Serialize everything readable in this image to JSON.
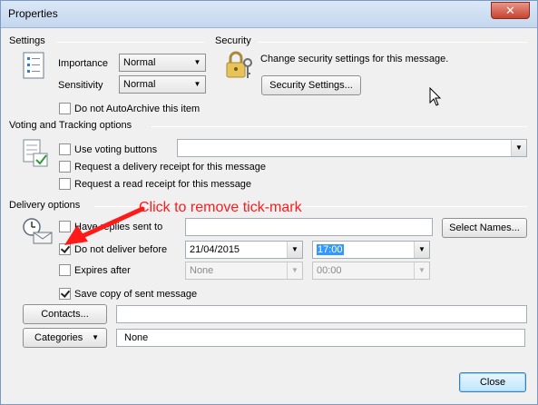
{
  "window": {
    "title": "Properties",
    "close_glyph": "✕"
  },
  "settings": {
    "heading": "Settings",
    "importance_label": "Importance",
    "importance_value": "Normal",
    "sensitivity_label": "Sensitivity",
    "sensitivity_value": "Normal",
    "autoarchive_label": "Do not AutoArchive this item",
    "autoarchive_checked": false
  },
  "security": {
    "heading": "Security",
    "description": "Change security settings for this message.",
    "button_label": "Security Settings..."
  },
  "voting": {
    "heading": "Voting and Tracking options",
    "use_voting_label": "Use voting buttons",
    "voting_value": "",
    "delivery_receipt_label": "Request a delivery receipt for this message",
    "read_receipt_label": "Request a read receipt for this message"
  },
  "delivery": {
    "heading": "Delivery options",
    "have_replies_label": "Have replies sent to",
    "replies_value": "",
    "select_names_label": "Select Names...",
    "do_not_deliver_label": "Do not deliver before",
    "do_not_deliver_checked": true,
    "deliver_date": "21/04/2015",
    "deliver_time": "17:00",
    "expires_label": "Expires after",
    "expires_checked": false,
    "expires_date": "None",
    "expires_time": "00:00",
    "save_copy_label": "Save copy of sent message",
    "save_copy_checked": true
  },
  "contacts": {
    "button_label": "Contacts...",
    "value": ""
  },
  "categories": {
    "button_label": "Categories",
    "value": "None"
  },
  "footer": {
    "close_label": "Close"
  },
  "annotation": {
    "text": "Click to remove tick-mark",
    "color": "#ff1a1a"
  },
  "icons": {
    "arrow_glyph": "▼",
    "settings_icon": "document-list-icon",
    "security_icon": "padlock-key-icon",
    "voting_icon": "document-check-icon",
    "delivery_icon": "clock-envelope-icon"
  }
}
